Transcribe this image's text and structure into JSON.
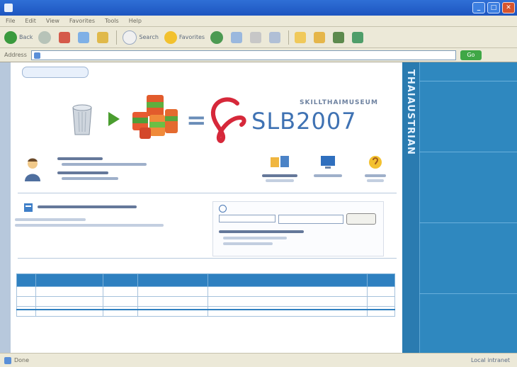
{
  "browser": {
    "title": "",
    "menu": [
      "File",
      "Edit",
      "View",
      "Favorites",
      "Tools",
      "Help"
    ],
    "toolbar": {
      "back_label": "Back",
      "search_label": "Search",
      "favorites_label": "Favorites"
    },
    "address": {
      "label": "Address",
      "url": "",
      "go_label": "Go"
    },
    "status": {
      "left": "Done",
      "right": "Local intranet"
    }
  },
  "site": {
    "side_vertical_text": "THAIAUSTRIAN",
    "top_links": "",
    "logo": {
      "sub_text": "SKILLTHAIMUSEUM",
      "main_text": "SLB2007"
    },
    "search": {
      "title": "",
      "select_value": "",
      "button_label": ""
    },
    "table": {
      "title": "",
      "headers": [
        "",
        "",
        "",
        "",
        "",
        ""
      ],
      "rows": [
        [
          "",
          "",
          "",
          "",
          "",
          ""
        ],
        [
          "",
          "",
          "",
          "",
          "",
          ""
        ],
        [
          "",
          "",
          "",
          "",
          "",
          ""
        ]
      ]
    },
    "footer": [
      "",
      ""
    ]
  }
}
